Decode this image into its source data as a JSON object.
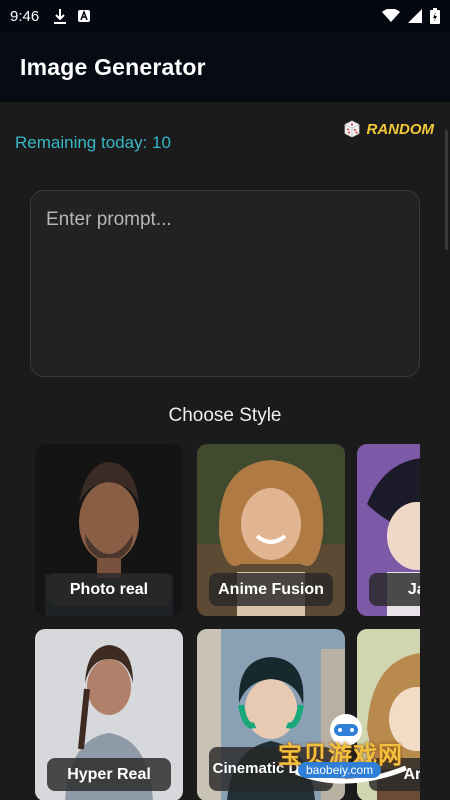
{
  "status_bar": {
    "time": "9:46",
    "left_icons": [
      "download-icon",
      "app-notification-icon"
    ],
    "right_icons": [
      "wifi-icon",
      "signal-icon",
      "battery-charging-icon"
    ]
  },
  "app_bar": {
    "title": "Image Generator"
  },
  "header": {
    "remaining_text": "Remaining today: 10",
    "random_label": "RANDOM",
    "random_icon": "dice-icon"
  },
  "prompt": {
    "placeholder": "Enter prompt...",
    "value": ""
  },
  "styles_section": {
    "heading": "Choose Style",
    "cards": [
      {
        "label": "Photo real"
      },
      {
        "label": "Anime Fusion"
      },
      {
        "label": "Japan"
      },
      {
        "label": "Hyper Real"
      },
      {
        "label": "Cinematic Detail"
      },
      {
        "label": "Artistic"
      }
    ]
  },
  "watermark": {
    "text": "宝贝游戏网",
    "url": "baobeiy.com"
  },
  "colors": {
    "accent_cyan": "#36b7c6",
    "accent_yellow": "#f3c93b",
    "background": "#1b1b1b",
    "app_bar": "#070b14"
  }
}
